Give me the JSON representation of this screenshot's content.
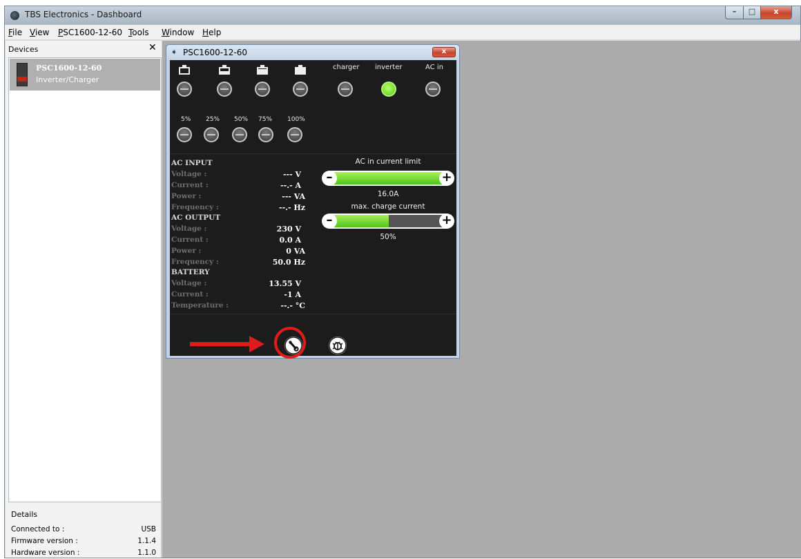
{
  "window": {
    "title": "TBS Electronics - Dashboard",
    "controls": {
      "minimize": "–",
      "maximize": "□",
      "close": "x"
    }
  },
  "menu": [
    {
      "pre": "",
      "u": "F",
      "post": "ile"
    },
    {
      "pre": "",
      "u": "V",
      "post": "iew"
    },
    {
      "pre": "",
      "u": "P",
      "post": "SC1600-12-60"
    },
    {
      "pre": "",
      "u": "T",
      "post": "ools"
    },
    {
      "pre": "",
      "u": "W",
      "post": "indow"
    },
    {
      "pre": "",
      "u": "H",
      "post": "elp"
    }
  ],
  "devices_panel": {
    "title": "Devices",
    "close": "✕",
    "items": [
      {
        "name": "PSC1600-12-60",
        "type": "Inverter/Charger"
      }
    ]
  },
  "details": {
    "title": "Details",
    "rows": [
      {
        "label": "Connected to :",
        "value": "USB"
      },
      {
        "label": "Firmware version :",
        "value": "1.1.4"
      },
      {
        "label": "Hardware version :",
        "value": "1.1.0"
      }
    ]
  },
  "child_window": {
    "icon": "diamond-arrow-icon",
    "title": "PSC1600-12-60",
    "close": "x"
  },
  "indicators": {
    "battery_leds": [
      {
        "level": 0.0,
        "on": false
      },
      {
        "level": 0.33,
        "on": false
      },
      {
        "level": 0.66,
        "on": false
      },
      {
        "level": 1.0,
        "on": false
      }
    ],
    "status_leds": [
      {
        "label": "charger",
        "on": false
      },
      {
        "label": "inverter",
        "on": true,
        "color": "#7ee02f"
      },
      {
        "label": "AC in",
        "on": false
      }
    ],
    "soc_leds": [
      {
        "label": "5%",
        "on": false
      },
      {
        "label": "25%",
        "on": false
      },
      {
        "label": "50%",
        "on": false
      },
      {
        "label": "75%",
        "on": false
      },
      {
        "label": "100%",
        "on": false
      }
    ]
  },
  "measurements": {
    "ac_input": {
      "title": "AC INPUT",
      "rows": [
        {
          "label": "Voltage :",
          "value": "--- V"
        },
        {
          "label": "Current :",
          "value": "--.- A"
        },
        {
          "label": "Power :",
          "value": "--- VA"
        },
        {
          "label": "Frequency :",
          "value": "--.- Hz"
        }
      ]
    },
    "ac_output": {
      "title": "AC OUTPUT",
      "rows": [
        {
          "label": "Voltage :",
          "value": "230 V"
        },
        {
          "label": "Current :",
          "value": "0.0 A"
        },
        {
          "label": "Power :",
          "value": "0 VA"
        },
        {
          "label": "Frequency :",
          "value": "50.0 Hz"
        }
      ]
    },
    "battery": {
      "title": "BATTERY",
      "rows": [
        {
          "label": "Voltage :",
          "value": "13.55 V"
        },
        {
          "label": "Current :",
          "value": "-1 A"
        },
        {
          "label": "Temperature :",
          "value": "--.- °C"
        }
      ]
    }
  },
  "sliders": {
    "ac_current_limit": {
      "label": "AC in current limit",
      "value": "16.0A",
      "fraction": 1.0
    },
    "max_charge_current": {
      "label": "max. charge current",
      "value": "50%",
      "fraction": 0.5
    },
    "minus": "–",
    "plus": "+"
  },
  "toolbar": {
    "settings_icon": "wrench-icon",
    "debug_icon": "bug-icon"
  },
  "annotation": {
    "color": "#e01b1b"
  }
}
